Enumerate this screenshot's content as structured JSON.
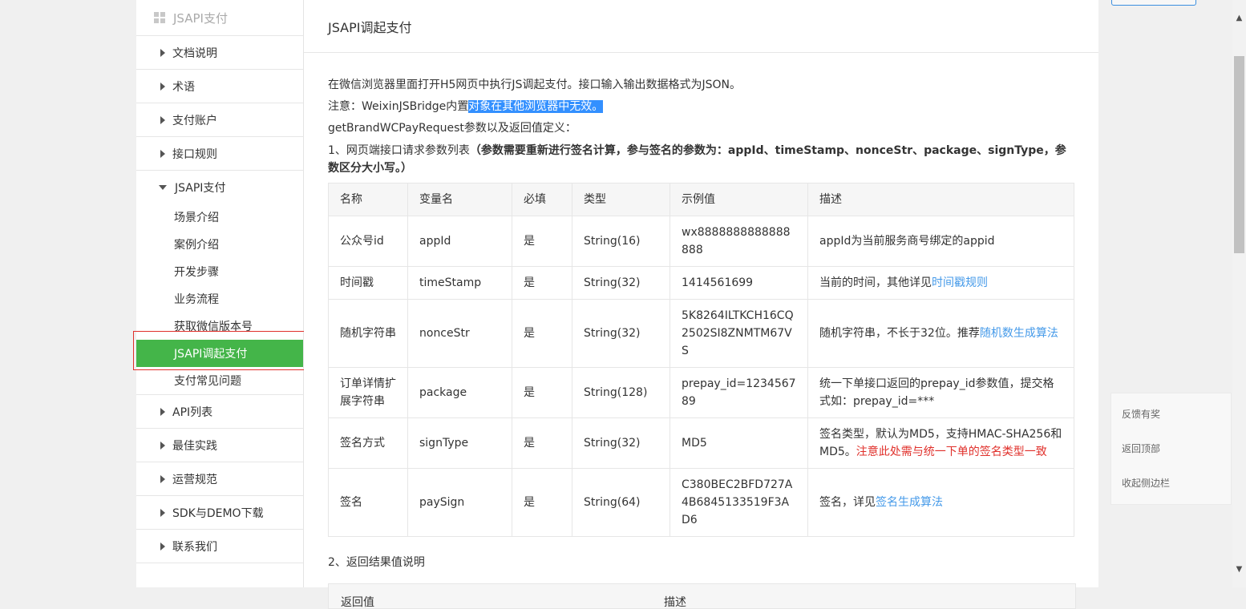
{
  "sidebar": {
    "header": "JSAPI支付",
    "items_before": [
      "文档说明",
      "术语",
      "支付账户",
      "接口规则"
    ],
    "group": {
      "label": "JSAPI支付",
      "subitems": [
        "场景介绍",
        "案例介绍",
        "开发步骤",
        "业务流程",
        "获取微信版本号",
        "JSAPI调起支付",
        "支付常见问题"
      ]
    },
    "items_after": [
      "API列表",
      "最佳实践",
      "运营规范",
      "SDK与DEMO下载",
      "联系我们"
    ]
  },
  "main": {
    "title": "JSAPI调起支付",
    "intro": "在微信浏览器里面打开H5网页中执行JS调起支付。接口输入输出数据格式为JSON。",
    "note_prefix": "注意：WeixinJSBridge内置",
    "note_highlight": "对象在其他浏览器中无效。",
    "param_def": "getBrandWCPayRequest参数以及返回值定义：",
    "section1_prefix": "1、网页端接口请求参数列表",
    "section1_bold": "（参数需要重新进行签名计算，参与签名的参数为：appId、timeStamp、nonceStr、package、signType，参数区分大小写。）",
    "table": {
      "headers": [
        "名称",
        "变量名",
        "必填",
        "类型",
        "示例值",
        "描述"
      ],
      "rows": [
        {
          "name": "公众号id",
          "var": "appId",
          "req": "是",
          "type": "String(16)",
          "example": "wx8888888888888888",
          "desc": "appId为当前服务商号绑定的appid",
          "link": "",
          "warn": ""
        },
        {
          "name": "时间戳",
          "var": "timeStamp",
          "req": "是",
          "type": "String(32)",
          "example": "1414561699",
          "desc": "当前的时间，其他详见",
          "link": "时间戳规则",
          "warn": ""
        },
        {
          "name": "随机字符串",
          "var": "nonceStr",
          "req": "是",
          "type": "String(32)",
          "example": "5K8264ILTKCH16CQ2502SI8ZNMTM67VS",
          "desc": "随机字符串，不长于32位。推荐",
          "link": "随机数生成算法",
          "warn": ""
        },
        {
          "name": "订单详情扩展字符串",
          "var": "package",
          "req": "是",
          "type": "String(128)",
          "example": "prepay_id=123456789",
          "desc": "统一下单接口返回的prepay_id参数值，提交格式如：prepay_id=***",
          "link": "",
          "warn": ""
        },
        {
          "name": "签名方式",
          "var": "signType",
          "req": "是",
          "type": "String(32)",
          "example": "MD5",
          "desc": "签名类型，默认为MD5，支持HMAC-SHA256和MD5。",
          "link": "",
          "warn": "注意此处需与统一下单的签名类型一致"
        },
        {
          "name": "签名",
          "var": "paySign",
          "req": "是",
          "type": "String(64)",
          "example": "C380BEC2BFD727A4B6845133519F3AD6",
          "desc": "签名，详见",
          "link": "签名生成算法",
          "warn": ""
        }
      ]
    },
    "section2": "2、返回结果值说明",
    "table2_headers": [
      "返回值",
      "描述"
    ]
  },
  "float_panel": [
    "反馈有奖",
    "返回顶部",
    "收起侧边栏"
  ],
  "colors": {
    "active_green": "#44b549",
    "link_blue": "#459ae9",
    "warn_red": "#e0302b",
    "highlight_blue": "#3390ff"
  }
}
